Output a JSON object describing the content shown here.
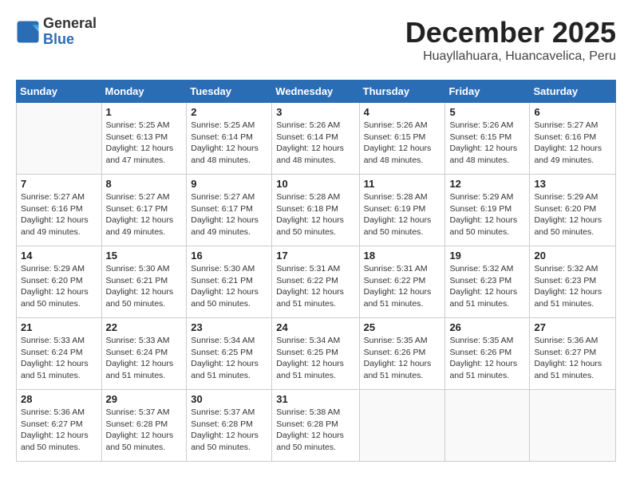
{
  "header": {
    "logo_line1": "General",
    "logo_line2": "Blue",
    "month": "December 2025",
    "location": "Huayllahuara, Huancavelica, Peru"
  },
  "weekdays": [
    "Sunday",
    "Monday",
    "Tuesday",
    "Wednesday",
    "Thursday",
    "Friday",
    "Saturday"
  ],
  "weeks": [
    [
      {
        "day": "",
        "info": ""
      },
      {
        "day": "1",
        "info": "Sunrise: 5:25 AM\nSunset: 6:13 PM\nDaylight: 12 hours\nand 47 minutes."
      },
      {
        "day": "2",
        "info": "Sunrise: 5:25 AM\nSunset: 6:14 PM\nDaylight: 12 hours\nand 48 minutes."
      },
      {
        "day": "3",
        "info": "Sunrise: 5:26 AM\nSunset: 6:14 PM\nDaylight: 12 hours\nand 48 minutes."
      },
      {
        "day": "4",
        "info": "Sunrise: 5:26 AM\nSunset: 6:15 PM\nDaylight: 12 hours\nand 48 minutes."
      },
      {
        "day": "5",
        "info": "Sunrise: 5:26 AM\nSunset: 6:15 PM\nDaylight: 12 hours\nand 48 minutes."
      },
      {
        "day": "6",
        "info": "Sunrise: 5:27 AM\nSunset: 6:16 PM\nDaylight: 12 hours\nand 49 minutes."
      }
    ],
    [
      {
        "day": "7",
        "info": "Sunrise: 5:27 AM\nSunset: 6:16 PM\nDaylight: 12 hours\nand 49 minutes."
      },
      {
        "day": "8",
        "info": "Sunrise: 5:27 AM\nSunset: 6:17 PM\nDaylight: 12 hours\nand 49 minutes."
      },
      {
        "day": "9",
        "info": "Sunrise: 5:27 AM\nSunset: 6:17 PM\nDaylight: 12 hours\nand 49 minutes."
      },
      {
        "day": "10",
        "info": "Sunrise: 5:28 AM\nSunset: 6:18 PM\nDaylight: 12 hours\nand 50 minutes."
      },
      {
        "day": "11",
        "info": "Sunrise: 5:28 AM\nSunset: 6:19 PM\nDaylight: 12 hours\nand 50 minutes."
      },
      {
        "day": "12",
        "info": "Sunrise: 5:29 AM\nSunset: 6:19 PM\nDaylight: 12 hours\nand 50 minutes."
      },
      {
        "day": "13",
        "info": "Sunrise: 5:29 AM\nSunset: 6:20 PM\nDaylight: 12 hours\nand 50 minutes."
      }
    ],
    [
      {
        "day": "14",
        "info": "Sunrise: 5:29 AM\nSunset: 6:20 PM\nDaylight: 12 hours\nand 50 minutes."
      },
      {
        "day": "15",
        "info": "Sunrise: 5:30 AM\nSunset: 6:21 PM\nDaylight: 12 hours\nand 50 minutes."
      },
      {
        "day": "16",
        "info": "Sunrise: 5:30 AM\nSunset: 6:21 PM\nDaylight: 12 hours\nand 50 minutes."
      },
      {
        "day": "17",
        "info": "Sunrise: 5:31 AM\nSunset: 6:22 PM\nDaylight: 12 hours\nand 51 minutes."
      },
      {
        "day": "18",
        "info": "Sunrise: 5:31 AM\nSunset: 6:22 PM\nDaylight: 12 hours\nand 51 minutes."
      },
      {
        "day": "19",
        "info": "Sunrise: 5:32 AM\nSunset: 6:23 PM\nDaylight: 12 hours\nand 51 minutes."
      },
      {
        "day": "20",
        "info": "Sunrise: 5:32 AM\nSunset: 6:23 PM\nDaylight: 12 hours\nand 51 minutes."
      }
    ],
    [
      {
        "day": "21",
        "info": "Sunrise: 5:33 AM\nSunset: 6:24 PM\nDaylight: 12 hours\nand 51 minutes."
      },
      {
        "day": "22",
        "info": "Sunrise: 5:33 AM\nSunset: 6:24 PM\nDaylight: 12 hours\nand 51 minutes."
      },
      {
        "day": "23",
        "info": "Sunrise: 5:34 AM\nSunset: 6:25 PM\nDaylight: 12 hours\nand 51 minutes."
      },
      {
        "day": "24",
        "info": "Sunrise: 5:34 AM\nSunset: 6:25 PM\nDaylight: 12 hours\nand 51 minutes."
      },
      {
        "day": "25",
        "info": "Sunrise: 5:35 AM\nSunset: 6:26 PM\nDaylight: 12 hours\nand 51 minutes."
      },
      {
        "day": "26",
        "info": "Sunrise: 5:35 AM\nSunset: 6:26 PM\nDaylight: 12 hours\nand 51 minutes."
      },
      {
        "day": "27",
        "info": "Sunrise: 5:36 AM\nSunset: 6:27 PM\nDaylight: 12 hours\nand 51 minutes."
      }
    ],
    [
      {
        "day": "28",
        "info": "Sunrise: 5:36 AM\nSunset: 6:27 PM\nDaylight: 12 hours\nand 50 minutes."
      },
      {
        "day": "29",
        "info": "Sunrise: 5:37 AM\nSunset: 6:28 PM\nDaylight: 12 hours\nand 50 minutes."
      },
      {
        "day": "30",
        "info": "Sunrise: 5:37 AM\nSunset: 6:28 PM\nDaylight: 12 hours\nand 50 minutes."
      },
      {
        "day": "31",
        "info": "Sunrise: 5:38 AM\nSunset: 6:28 PM\nDaylight: 12 hours\nand 50 minutes."
      },
      {
        "day": "",
        "info": ""
      },
      {
        "day": "",
        "info": ""
      },
      {
        "day": "",
        "info": ""
      }
    ]
  ]
}
